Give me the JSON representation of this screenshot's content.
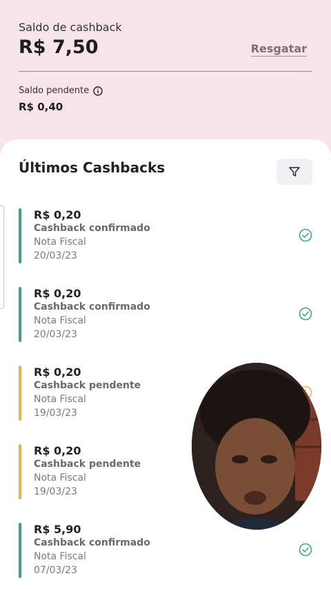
{
  "header": {
    "balance_label": "Saldo de cashback",
    "balance_value": "R$ 7,50",
    "redeem_label": "Resgatar",
    "pending_label": "Saldo pendente",
    "pending_value": "R$ 0,40"
  },
  "list": {
    "title": "Últimos Cashbacks",
    "items": [
      {
        "amount": "R$ 0,20",
        "status": "Cashback confirmado",
        "source": "Nota Fiscal",
        "date": "20/03/23",
        "state": "confirmed"
      },
      {
        "amount": "R$ 0,20",
        "status": "Cashback confirmado",
        "source": "Nota Fiscal",
        "date": "20/03/23",
        "state": "confirmed"
      },
      {
        "amount": "R$ 0,20",
        "status": "Cashback pendente",
        "source": "Nota Fiscal",
        "date": "19/03/23",
        "state": "pending"
      },
      {
        "amount": "R$ 0,20",
        "status": "Cashback pendente",
        "source": "Nota Fiscal",
        "date": "19/03/23",
        "state": "pending"
      },
      {
        "amount": "R$ 5,90",
        "status": "Cashback confirmado",
        "source": "Nota Fiscal",
        "date": "07/03/23",
        "state": "confirmed"
      }
    ]
  },
  "colors": {
    "confirmed": "#3aa58a",
    "pending": "#e9b24a",
    "header_bg": "#f7e4ea"
  },
  "icons": {
    "info": "info-icon",
    "filter": "filter-icon",
    "confirmed": "check-circle-icon",
    "pending": "clock-circle-icon"
  }
}
